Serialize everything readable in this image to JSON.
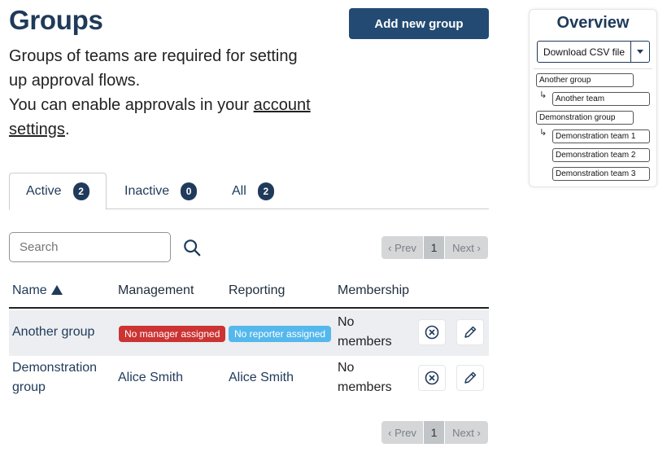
{
  "header": {
    "title": "Groups",
    "intro_line1": "Groups of teams are required for setting up approval flows.",
    "intro_line2_prefix": "You can enable approvals in your ",
    "intro_link": "account settings",
    "intro_line2_suffix": ".",
    "add_button": "Add new group"
  },
  "tabs": [
    {
      "label": "Active",
      "count": "2"
    },
    {
      "label": "Inactive",
      "count": "0"
    },
    {
      "label": "All",
      "count": "2"
    }
  ],
  "search": {
    "placeholder": "Search",
    "icon": "search-icon"
  },
  "pagination": {
    "prev": "‹ Prev",
    "page": "1",
    "next": "Next ›"
  },
  "table": {
    "columns": [
      "Name",
      "Management",
      "Reporting",
      "Membership"
    ],
    "sort": {
      "column": "Name",
      "direction": "ascending"
    },
    "rows": [
      {
        "name": "Another group",
        "management": "No manager assigned",
        "reporting": "No reporter assigned",
        "membership": "No members"
      },
      {
        "name": "Demonstration group",
        "management": "Alice Smith",
        "reporting": "Alice Smith",
        "membership": "No members"
      }
    ]
  },
  "overview": {
    "title": "Overview",
    "download_button": "Download CSV file",
    "tree": [
      {
        "group": "Another group",
        "teams": [
          "Another team"
        ]
      },
      {
        "group": "Demonstration group",
        "teams": [
          "Demonstration team 1",
          "Demonstration team 2",
          "Demonstration team 3"
        ]
      }
    ]
  },
  "colors": {
    "primary": "#234a72",
    "badge": "#1f3a5a",
    "danger_label": "#cc3333",
    "info_label": "#55b8ec",
    "row_highlight": "#eceef1"
  }
}
